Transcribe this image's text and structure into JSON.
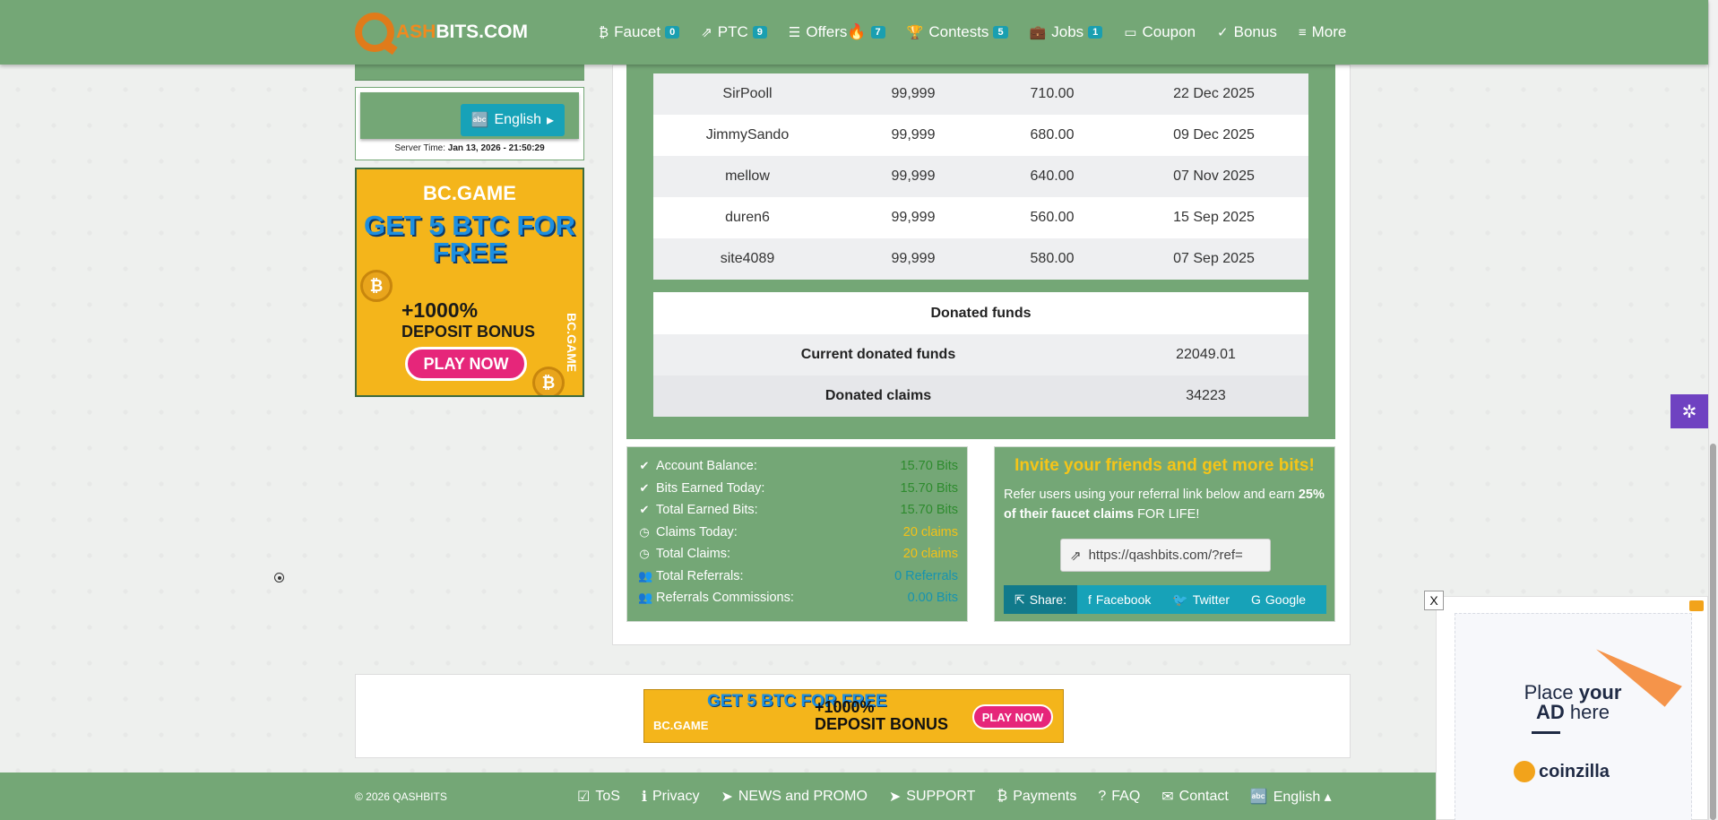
{
  "brand": {
    "part1": "ASH",
    "part2": "BITS.COM"
  },
  "nav": [
    {
      "icon": "₿",
      "label": "Faucet",
      "badge": "0"
    },
    {
      "icon": "⇗",
      "label": "PTC",
      "badge": "9"
    },
    {
      "icon": "☰",
      "label": "Offers🔥",
      "badge": "7"
    },
    {
      "icon": "🏆",
      "label": "Contests",
      "badge": "5"
    },
    {
      "icon": "💼",
      "label": "Jobs",
      "badge": "1"
    },
    {
      "icon": "▭",
      "label": "Coupon",
      "badge": ""
    },
    {
      "icon": "✓",
      "label": "Bonus",
      "badge": ""
    },
    {
      "icon": "≡",
      "label": "More",
      "badge": ""
    }
  ],
  "sidebar": {
    "language_button": "English",
    "server_time_label": "Server Time:",
    "server_time_value": "Jan 13, 2026 - 21:50:29",
    "ad": {
      "brand": "BC.GAME",
      "headline": "GET 5 BTC FOR FREE",
      "bonus_pct": "+1000%",
      "bonus_text": "DEPOSIT BONUS",
      "cta": "PLAY NOW"
    }
  },
  "leaderboard": {
    "rows": [
      {
        "user": "SirPooll",
        "a": "99,999",
        "b": "710.00",
        "date": "22 Dec 2025"
      },
      {
        "user": "JimmySando",
        "a": "99,999",
        "b": "680.00",
        "date": "09 Dec 2025"
      },
      {
        "user": "mellow",
        "a": "99,999",
        "b": "640.00",
        "date": "07 Nov 2025"
      },
      {
        "user": "duren6",
        "a": "99,999",
        "b": "560.00",
        "date": "15 Sep 2025"
      },
      {
        "user": "site4089",
        "a": "99,999",
        "b": "580.00",
        "date": "07 Sep 2025"
      }
    ]
  },
  "donated": {
    "title": "Donated funds",
    "current_label": "Current donated funds",
    "current_value": "22049.01",
    "claims_label": "Donated claims",
    "claims_value": "34223"
  },
  "stats": [
    {
      "icon": "check-circle-icon",
      "label": "Account Balance:",
      "value": "15.70 Bits",
      "color": "#2e8b2e"
    },
    {
      "icon": "check-circle-icon",
      "label": "Bits Earned Today:",
      "value": "15.70 Bits",
      "color": "#2e8b2e"
    },
    {
      "icon": "check-circle-icon",
      "label": "Total Earned Bits:",
      "value": "15.70 Bits",
      "color": "#2e8b2e"
    },
    {
      "icon": "clock-icon",
      "label": "Claims Today:",
      "value": "20 claims",
      "color": "#f4c117"
    },
    {
      "icon": "clock-icon",
      "label": "Total Claims:",
      "value": "20 claims",
      "color": "#f4c117"
    },
    {
      "icon": "users-icon",
      "label": "Total Referrals:",
      "value": "0 Referrals",
      "color": "#1793b0"
    },
    {
      "icon": "users-icon",
      "label": "Referrals Commissions:",
      "value": "0.00 Bits",
      "color": "#1793b0"
    }
  ],
  "invite": {
    "title": "Invite your friends and get more bits!",
    "text1": "Refer users using your referral link below and earn",
    "text_bold": "25% of their faucet claims",
    "text2": " FOR LIFE!",
    "link": "https://qashbits.com/?ref=",
    "share_label": "Share:",
    "facebook": "Facebook",
    "twitter": "Twitter",
    "google": "Google"
  },
  "bottom_ad": {
    "brand": "BC.GAME",
    "headline": "GET 5 BTC FOR FREE",
    "bonus_pct": "+1000%",
    "bonus_text": "DEPOSIT BONUS",
    "cta": "PLAY NOW"
  },
  "footer": {
    "copyright": "© 2026 QASHBITS",
    "links": [
      {
        "icon": "☑",
        "label": "ToS"
      },
      {
        "icon": "ℹ",
        "label": "Privacy"
      },
      {
        "icon": "➤",
        "label": "NEWS and PROMO"
      },
      {
        "icon": "➤",
        "label": "SUPPORT"
      },
      {
        "icon": "₿",
        "label": "Payments"
      },
      {
        "icon": "?",
        "label": "FAQ"
      },
      {
        "icon": "✉",
        "label": "Contact"
      },
      {
        "icon": "🔤",
        "label": "English ▴"
      }
    ]
  },
  "coinzilla": {
    "close": "X",
    "place": "Place ",
    "your": "your",
    "ad": "AD",
    "here": " here",
    "brand": "coinzilla"
  }
}
